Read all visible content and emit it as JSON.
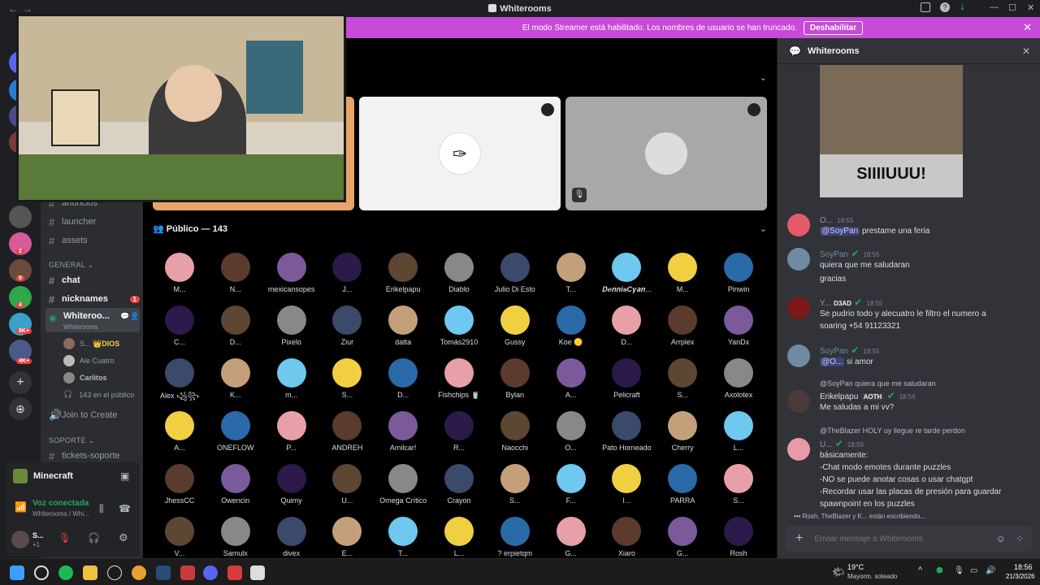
{
  "window": {
    "title": "Whiterooms",
    "back": "←",
    "forward": "→",
    "minimize": "—",
    "maximize": "☐",
    "close": "✕"
  },
  "banner": {
    "text": "El modo Streamer está habilitado. Los nombres de usuario se han truncado.",
    "button": "Deshabilitar",
    "close": "✕"
  },
  "rail": {
    "badges": [
      "2",
      "9",
      "4",
      "8K+",
      "4K+"
    ],
    "add": "+",
    "discover": "⊕"
  },
  "sidebar": {
    "channels_top": [
      {
        "name": "anuncios"
      },
      {
        "name": "launcher"
      },
      {
        "name": "assets"
      }
    ],
    "category_general": "GENERAL ⌄",
    "channels_general": [
      {
        "name": "chat"
      },
      {
        "name": "nicknames",
        "badge": "1"
      }
    ],
    "voice_channel": {
      "name": "Whiteroo...",
      "subtitle": "Whiterooms"
    },
    "voice_users": [
      {
        "name": "S...",
        "tag": "👑DIOS"
      },
      {
        "name": "Ale Cuatro"
      },
      {
        "name": "Carlitos"
      }
    ],
    "public_count": "143 en el público",
    "join_create": "Join to Create",
    "category_support": "SOPORTE ⌄",
    "channels_support": [
      {
        "name": "tickets-soporte"
      }
    ]
  },
  "panel": {
    "game": "Minecraft",
    "voice_status": "Voz conectada",
    "voice_location": "Whiterooms / Whi...",
    "user": "S...",
    "user_sub": "+1"
  },
  "stage": {
    "public_header": "Público — 143",
    "audience": [
      [
        "M...",
        "N...",
        "mexicansopes",
        "J...",
        "Erikelpapu",
        "Diablo",
        "Julio Di Esto",
        "T...",
        "𝑫𝒆𝒏𝒏𝒊𝒔𝑪𝒚𝒂𝒏...",
        "M...",
        "Pinwin"
      ],
      [
        "C...",
        "D...",
        "Pixelo",
        "Ziur",
        "datta",
        "Tomás2910",
        "Gussy",
        "Koe 🟡",
        "D...",
        "Arrplex",
        "YanDx"
      ],
      [
        "Alex ꧁꧂",
        "K...",
        "m...",
        "S...",
        "D...",
        "Fishchips 🥤",
        "Bylan",
        "A...",
        "Pelicraft",
        "S...",
        "Axolotex"
      ],
      [
        "A...",
        "ONEFLOW",
        "P...",
        "ANDREH",
        "Amilcar!",
        "R...",
        "Naocchi",
        "O...",
        "Pato Horneado",
        "Cherry",
        "L..."
      ],
      [
        "JhessCC",
        "Owencin",
        "Quimy",
        "U...",
        "Omega Crítico",
        "Crayon",
        "S...",
        "F...",
        "I...",
        "PARRA",
        "S..."
      ],
      [
        "V...",
        "Samulx",
        "divex",
        "E...",
        "T...",
        "L...",
        "? erpietqm",
        "G...",
        "Xiaro",
        "G...",
        "Rosh"
      ]
    ],
    "colors": [
      "#e8a0a8",
      "#5a3b2e",
      "#7a5a9a",
      "#2b1a4a",
      "#5d4632",
      "#888888",
      "#3b4a6b",
      "#c4a07a",
      "#6ec8f0",
      "#f0d040",
      "#2a6aa8"
    ]
  },
  "chat": {
    "title": "Whiterooms",
    "close": "✕",
    "image_caption": "SIIIIUUU!",
    "messages": [
      {
        "user": "O...",
        "time": "18:55",
        "mention": "@SoyPan",
        "text": "prestame una feria",
        "color": "#e55a6a"
      },
      {
        "user": "SoyPan",
        "time": "18:55",
        "text": "quiera que me saludaran",
        "text2": "gracias",
        "color": "#6f8aa3"
      },
      {
        "user": "Y...",
        "tag": "D3AD",
        "time": "18:55",
        "text": "Se pudrio todo y alecuatro le filtro el numero a",
        "text2": "soaring +54 91123321",
        "color": "#7a1a1a"
      },
      {
        "user": "SoyPan",
        "time": "18:55",
        "mention": "@O...",
        "text": "si amor",
        "color": "#6f8aa3"
      },
      {
        "reply": "@SoyPan quiera que me saludaran",
        "user": "Erikelpapu",
        "tag": "AOTH",
        "time": "18:56",
        "text": "Me saludas a mi vv?",
        "color": "#4a3a3a"
      },
      {
        "reply": "@TheBlazer HOLY uy llegue re tarde perdon",
        "user": "U...",
        "time": "18:56",
        "lines": [
          "básicamente:",
          "-Chat modo emotes durante puzzles",
          "-NO se puede anotar cosas o usar chatgpt",
          "-Recordar usar las placas de presión para guardar",
          "spawnpoint en los puzzles"
        ],
        "color": "#e89aa8"
      }
    ],
    "typing": "Rosh, TheBlazer y K... están escribiendo...",
    "composer_placeholder": "Enviar mensaje a Whiterooms"
  },
  "taskbar": {
    "weather_temp": "19°C",
    "weather_desc": "Mayorm. soleado",
    "time": "18:56",
    "date": "21/3/2026"
  }
}
